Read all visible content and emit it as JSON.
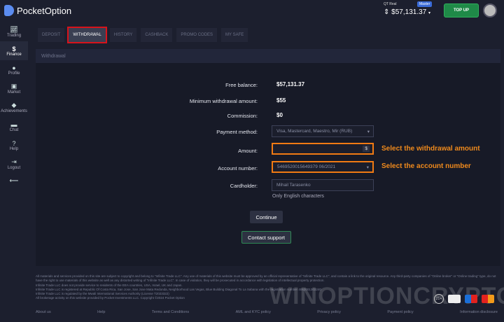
{
  "header": {
    "brand": "PocketOption",
    "account_label": "QT Real",
    "account_badge": "Master",
    "balance": "$57,131.37",
    "topup_label": "TOP UP"
  },
  "sidebar": {
    "items": [
      {
        "label": "Trading",
        "icon": "chart-icon"
      },
      {
        "label": "Finance",
        "icon": "dollar-icon"
      },
      {
        "label": "Profile",
        "icon": "person-icon"
      },
      {
        "label": "Market",
        "icon": "cart-icon"
      },
      {
        "label": "Achievements",
        "icon": "diamond-icon"
      },
      {
        "label": "Chat",
        "icon": "chat-icon"
      },
      {
        "label": "Help",
        "icon": "help-icon"
      },
      {
        "label": "Logout",
        "icon": "logout-icon"
      }
    ]
  },
  "tabs": [
    "DEPOSIT",
    "WITHDRAWAL",
    "HISTORY",
    "CASHBACK",
    "PROMO CODES",
    "MY SAFE"
  ],
  "panel": {
    "title": "Withdrawal",
    "free_balance_label": "Free balance:",
    "free_balance": "$57,131.37",
    "min_label": "Minimum withdrawal amount:",
    "min_value": "$55",
    "commission_label": "Commission:",
    "commission": "$0",
    "method_label": "Payment method:",
    "method_value": "Visa, Mastercard, Maestro, Mir (RUB)",
    "amount_label": "Amount:",
    "amount_value": "",
    "amount_currency": "$",
    "account_label": "Account number:",
    "account_value": "5469520015649379 06/2021",
    "cardholder_label": "Cardholder:",
    "cardholder_value": "Mihail Tarasenko",
    "cardholder_hint": "Only English characters",
    "continue_label": "Continue",
    "support_label": "Contact support"
  },
  "annotations": {
    "amount": "Select the withdrawal amount",
    "account": "Select the account number"
  },
  "footer": {
    "lines": [
      "All materials and services provided on this site are subject to copyright and belong to \"Infinite Trade LLC\". Any use of materials of this website must be approved by an official representative of \"Infinite Trade LLC\", and contain a link to the original resource. Any third-party companies of \"Online broker\" or \"Online trading\" type, do not have the right to use materials of this website as well as any distorted writing of \"Infinite Trade LLC\". In case of violation, they will be prosecuted in accordance with legislation of intellectual property protection.",
      "Infinite Trade LLC does not provide service to residents of the EEA countries, USA, Israel, UK and Japan.",
      "Infinite Trade LLC is registered at Republic Of Costa Rica, San Jose, San Jose Mata Redonda, Neighborhood Las Vegas, Blue Building Diagonal To La Sabana with the registration number 4062001303240",
      "Infinite Trade LLC is regulated by the Mwali International Services Authority (License T2023322)",
      "All brokerage activity on this website provided by Pocket Investments LLC. Copyright ©2024 Pocket Option"
    ],
    "links": [
      "About us",
      "Help",
      "Terms and Conditions",
      "AML and KYC policy",
      "Privacy policy",
      "Payment policy",
      "Information disclosure"
    ],
    "age": "21+",
    "watermark": "WINOPTIONCRYPTO.COM"
  }
}
